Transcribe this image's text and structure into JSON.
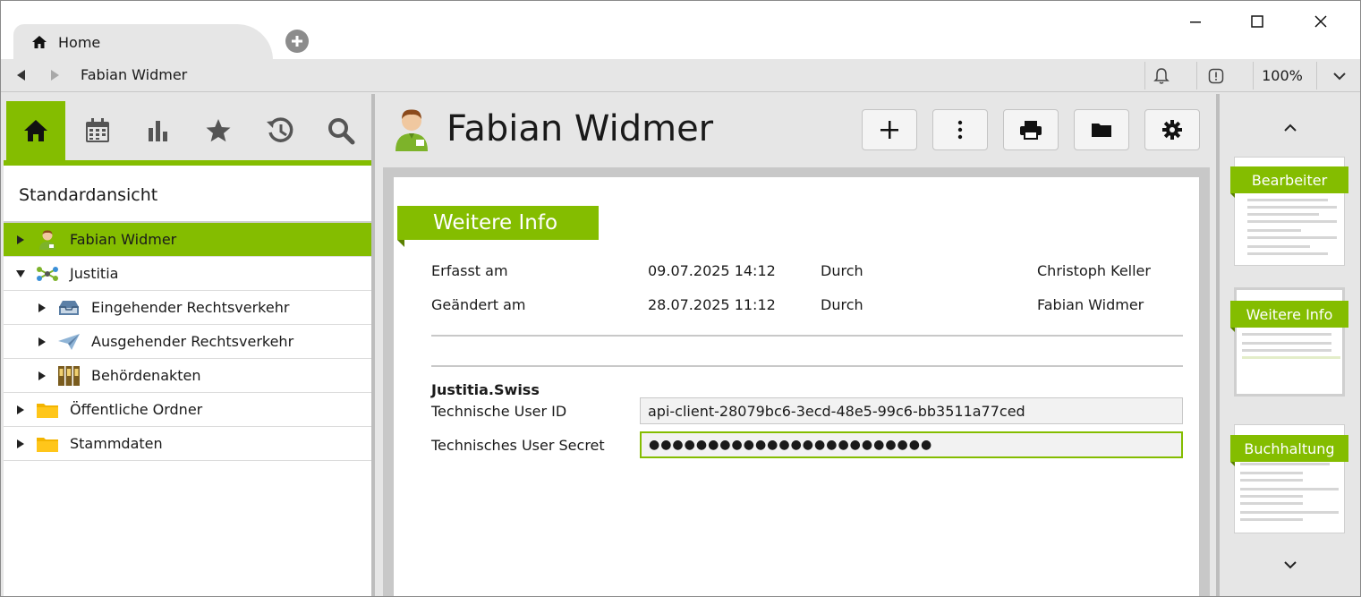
{
  "window": {
    "tab_title": "Home",
    "controls": {
      "minimize": "minimize",
      "maximize": "maximize",
      "close": "close"
    }
  },
  "navbar": {
    "title": "Fabian Widmer",
    "zoom": "100%"
  },
  "sidebar": {
    "view_title": "Standardansicht",
    "icons": [
      "home-icon",
      "calendar-icon",
      "chart-icon",
      "star-icon",
      "history-icon",
      "search-icon"
    ],
    "tree": [
      {
        "label": "Fabian Widmer",
        "level": 0,
        "expanded": false,
        "selected": true,
        "icon": "person-icon"
      },
      {
        "label": "Justitia",
        "level": 0,
        "expanded": true,
        "selected": false,
        "icon": "network-icon"
      },
      {
        "label": "Eingehender Rechtsverkehr",
        "level": 1,
        "expanded": false,
        "selected": false,
        "icon": "inbox-icon"
      },
      {
        "label": "Ausgehender Rechtsverkehr",
        "level": 1,
        "expanded": false,
        "selected": false,
        "icon": "paper-plane-icon"
      },
      {
        "label": "Behördenakten",
        "level": 1,
        "expanded": false,
        "selected": false,
        "icon": "binders-icon"
      },
      {
        "label": "Öffentliche Ordner",
        "level": 0,
        "expanded": false,
        "selected": false,
        "icon": "folder-icon"
      },
      {
        "label": "Stammdaten",
        "level": 0,
        "expanded": false,
        "selected": false,
        "icon": "folder-icon"
      }
    ]
  },
  "main": {
    "title": "Fabian Widmer",
    "section": "Weitere Info",
    "rows": [
      {
        "label": "Erfasst am",
        "date": "09.07.2025 14:12",
        "by_label": "Durch",
        "by": "Christoph Keller"
      },
      {
        "label": "Geändert am",
        "date": "28.07.2025 11:12",
        "by_label": "Durch",
        "by": "Fabian Widmer"
      }
    ],
    "group_title": "Justitia.Swiss",
    "user_id_label": "Technische User ID",
    "user_id_value": "api-client-28079bc6-3ecd-48e5-99c6-bb3511a77ced",
    "secret_label": "Technisches User Secret",
    "secret_value": "●●●●●●●●●●●●●●●●●●●●●●●●"
  },
  "rightpanel": {
    "thumbnails": [
      {
        "label": "Bearbeiter",
        "active": false
      },
      {
        "label": "Weitere Info",
        "active": true
      },
      {
        "label": "Buchhaltung",
        "active": false
      }
    ]
  },
  "colors": {
    "accent": "#84bd00",
    "accent_dark": "#5a8000",
    "background": "#e6e6e6"
  }
}
